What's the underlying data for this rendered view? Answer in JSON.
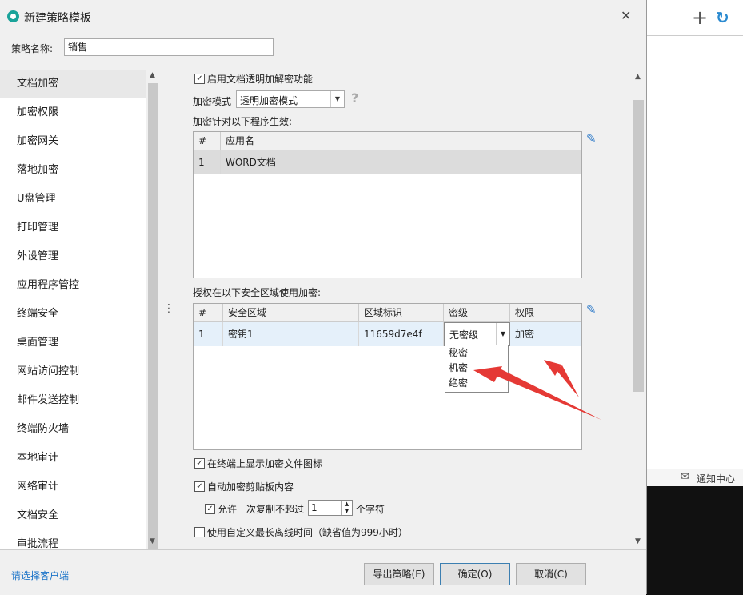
{
  "dialog": {
    "title": "新建策略模板",
    "close": "✕",
    "name_label": "策略名称:",
    "name_value": "销售"
  },
  "nav": {
    "items": [
      {
        "label": "文档加密"
      },
      {
        "label": "加密权限"
      },
      {
        "label": "加密网关"
      },
      {
        "label": "落地加密"
      },
      {
        "label": "U盘管理"
      },
      {
        "label": "打印管理"
      },
      {
        "label": "外设管理"
      },
      {
        "label": "应用程序管控"
      },
      {
        "label": "终端安全"
      },
      {
        "label": "桌面管理"
      },
      {
        "label": "网站访问控制"
      },
      {
        "label": "邮件发送控制"
      },
      {
        "label": "终端防火墙"
      },
      {
        "label": "本地审计"
      },
      {
        "label": "网络审计"
      },
      {
        "label": "文档安全"
      },
      {
        "label": "审批流程"
      }
    ],
    "active_index": 0
  },
  "content": {
    "enable_label": "启用文档透明加解密功能",
    "enable_checked": "✓",
    "mode_label": "加密模式",
    "mode_value": "透明加密模式",
    "help": "?",
    "apps_label": "加密针对以下程序生效:",
    "apps_table": {
      "headers": [
        "#",
        "应用名"
      ],
      "rows": [
        [
          "1",
          "WORD文档"
        ]
      ]
    },
    "zones_label": "授权在以下安全区域使用加密:",
    "zones_table": {
      "headers": [
        "#",
        "安全区域",
        "区域标识",
        "密级",
        "权限"
      ],
      "rows": [
        [
          "1",
          "密钥1",
          "11659d7e4f",
          "无密级",
          "加密"
        ]
      ]
    },
    "level_dropdown": [
      "秘密",
      "机密",
      "绝密"
    ],
    "show_icon_label": "在终端上显示加密文件图标",
    "show_icon_checked": "✓",
    "clipboard_label": "自动加密剪贴板内容",
    "clipboard_checked": "✓",
    "copy_limit_label": "允许一次复制不超过",
    "copy_limit_checked": "✓",
    "copy_limit_value": "1",
    "copy_limit_unit": "个字符",
    "offline_label": "使用自定义最长离线时间（缺省值为999小时）",
    "offline_checked": ""
  },
  "bottom": {
    "client_link": "请选择客户端",
    "export_label": "导出策略(E)",
    "ok_label": "确定(O)",
    "cancel_label": "取消(C)"
  },
  "background": {
    "add": "+",
    "refresh": "↻",
    "notify": "通知中心"
  },
  "colors": {
    "accent": "#1a73c8",
    "arrow": "#e53935"
  }
}
